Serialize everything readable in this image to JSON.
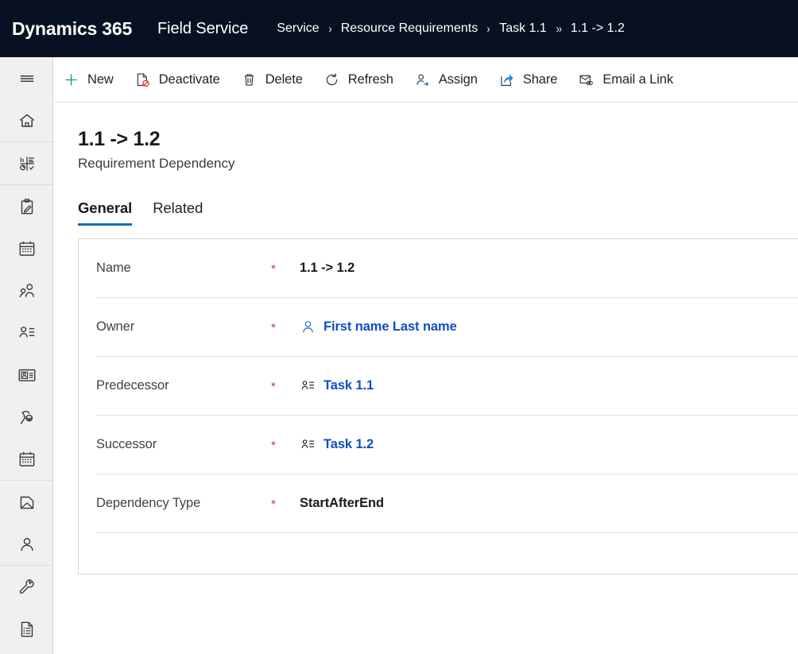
{
  "app_bar": {
    "brand": "Dynamics 365",
    "app_name": "Field Service",
    "breadcrumb": [
      {
        "label": "Service",
        "sep": "›"
      },
      {
        "label": "Resource Requirements",
        "sep": "›"
      },
      {
        "label": "Task 1.1",
        "sep": "››"
      },
      {
        "label": "1.1 -> 1.2",
        "sep": ""
      }
    ],
    "background": "#081121"
  },
  "nav_rail": {
    "items": [
      {
        "name": "site-map-menu-icon",
        "icon": "hamburger"
      },
      {
        "name": "home-icon",
        "icon": "home"
      },
      {
        "name": "dashboards-icon",
        "icon": "dashboard"
      },
      {
        "name": "work-orders-icon",
        "icon": "clipboard-edit"
      },
      {
        "name": "schedule-board-icon",
        "icon": "calendar"
      },
      {
        "name": "accounts-icon",
        "icon": "people"
      },
      {
        "name": "contacts-icon",
        "icon": "contact-list"
      },
      {
        "name": "resource-card-icon",
        "icon": "id-card"
      },
      {
        "name": "field-technician-icon",
        "icon": "technician"
      },
      {
        "name": "bookings-icon",
        "icon": "calendar"
      },
      {
        "name": "cases-icon",
        "icon": "folder"
      },
      {
        "name": "users-icon",
        "icon": "person"
      },
      {
        "name": "settings-tools-icon",
        "icon": "wrench"
      },
      {
        "name": "reports-icon",
        "icon": "document-list"
      }
    ]
  },
  "command_bar": {
    "buttons": [
      {
        "label": "New",
        "icon": "plus",
        "accent": "#1f9d55"
      },
      {
        "label": "Deactivate",
        "icon": "deactivate",
        "accent": "#d13438"
      },
      {
        "label": "Delete",
        "icon": "trash",
        "accent": "#323130"
      },
      {
        "label": "Refresh",
        "icon": "refresh",
        "accent": "#323130"
      },
      {
        "label": "Assign",
        "icon": "assign",
        "accent": "#0f6cbd"
      },
      {
        "label": "Share",
        "icon": "share",
        "accent": "#0f6cbd"
      },
      {
        "label": "Email a Link",
        "icon": "email-link",
        "accent": "#0f6cbd"
      }
    ]
  },
  "record": {
    "title": "1.1 -> 1.2",
    "subtitle": "Requirement Dependency"
  },
  "tabs": [
    {
      "label": "General",
      "active": true
    },
    {
      "label": "Related",
      "active": false
    }
  ],
  "form": {
    "rows": [
      {
        "label": "Name",
        "required": "*",
        "value": "1.1 -> 1.2",
        "icon": "none",
        "link": false
      },
      {
        "label": "Owner",
        "required": "*",
        "value": "First name Last name",
        "icon": "person-blue",
        "link": true
      },
      {
        "label": "Predecessor",
        "required": "*",
        "value": "Task 1.1",
        "icon": "resource-requirement",
        "link": true
      },
      {
        "label": "Successor",
        "required": "*",
        "value": "Task 1.2",
        "icon": "resource-requirement",
        "link": true
      },
      {
        "label": "Dependency Type",
        "required": "*",
        "value": "StartAfterEnd",
        "icon": "none",
        "link": false
      },
      {
        "label": "",
        "required": "",
        "value": "",
        "icon": "none",
        "link": false
      }
    ]
  },
  "colors": {
    "header_bg": "#081121",
    "accent_blue": "#0f6cbd",
    "link_blue": "#0f4ec4",
    "required_red": "#c0392b",
    "new_green": "#1f9d55",
    "rail_bg": "#f0f0f0"
  }
}
